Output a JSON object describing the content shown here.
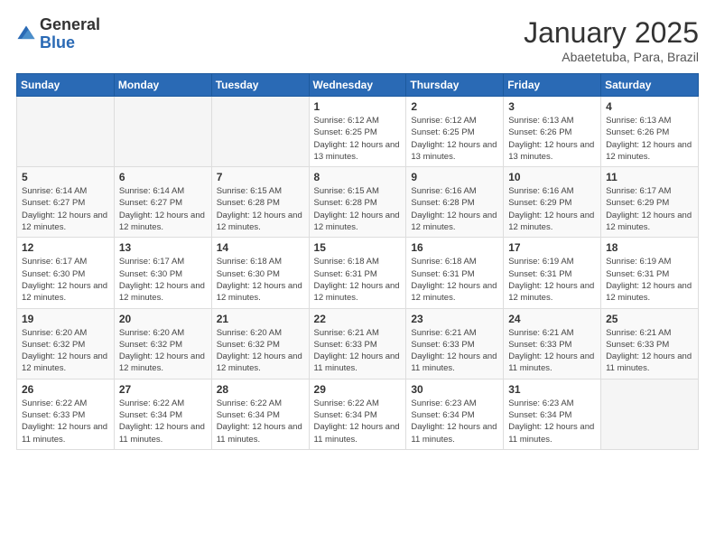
{
  "logo": {
    "general": "General",
    "blue": "Blue"
  },
  "title": "January 2025",
  "subtitle": "Abaetetuba, Para, Brazil",
  "weekdays": [
    "Sunday",
    "Monday",
    "Tuesday",
    "Wednesday",
    "Thursday",
    "Friday",
    "Saturday"
  ],
  "weeks": [
    [
      {
        "day": "",
        "info": ""
      },
      {
        "day": "",
        "info": ""
      },
      {
        "day": "",
        "info": ""
      },
      {
        "day": "1",
        "info": "Sunrise: 6:12 AM\nSunset: 6:25 PM\nDaylight: 12 hours and 13 minutes."
      },
      {
        "day": "2",
        "info": "Sunrise: 6:12 AM\nSunset: 6:25 PM\nDaylight: 12 hours and 13 minutes."
      },
      {
        "day": "3",
        "info": "Sunrise: 6:13 AM\nSunset: 6:26 PM\nDaylight: 12 hours and 13 minutes."
      },
      {
        "day": "4",
        "info": "Sunrise: 6:13 AM\nSunset: 6:26 PM\nDaylight: 12 hours and 12 minutes."
      }
    ],
    [
      {
        "day": "5",
        "info": "Sunrise: 6:14 AM\nSunset: 6:27 PM\nDaylight: 12 hours and 12 minutes."
      },
      {
        "day": "6",
        "info": "Sunrise: 6:14 AM\nSunset: 6:27 PM\nDaylight: 12 hours and 12 minutes."
      },
      {
        "day": "7",
        "info": "Sunrise: 6:15 AM\nSunset: 6:28 PM\nDaylight: 12 hours and 12 minutes."
      },
      {
        "day": "8",
        "info": "Sunrise: 6:15 AM\nSunset: 6:28 PM\nDaylight: 12 hours and 12 minutes."
      },
      {
        "day": "9",
        "info": "Sunrise: 6:16 AM\nSunset: 6:28 PM\nDaylight: 12 hours and 12 minutes."
      },
      {
        "day": "10",
        "info": "Sunrise: 6:16 AM\nSunset: 6:29 PM\nDaylight: 12 hours and 12 minutes."
      },
      {
        "day": "11",
        "info": "Sunrise: 6:17 AM\nSunset: 6:29 PM\nDaylight: 12 hours and 12 minutes."
      }
    ],
    [
      {
        "day": "12",
        "info": "Sunrise: 6:17 AM\nSunset: 6:30 PM\nDaylight: 12 hours and 12 minutes."
      },
      {
        "day": "13",
        "info": "Sunrise: 6:17 AM\nSunset: 6:30 PM\nDaylight: 12 hours and 12 minutes."
      },
      {
        "day": "14",
        "info": "Sunrise: 6:18 AM\nSunset: 6:30 PM\nDaylight: 12 hours and 12 minutes."
      },
      {
        "day": "15",
        "info": "Sunrise: 6:18 AM\nSunset: 6:31 PM\nDaylight: 12 hours and 12 minutes."
      },
      {
        "day": "16",
        "info": "Sunrise: 6:18 AM\nSunset: 6:31 PM\nDaylight: 12 hours and 12 minutes."
      },
      {
        "day": "17",
        "info": "Sunrise: 6:19 AM\nSunset: 6:31 PM\nDaylight: 12 hours and 12 minutes."
      },
      {
        "day": "18",
        "info": "Sunrise: 6:19 AM\nSunset: 6:31 PM\nDaylight: 12 hours and 12 minutes."
      }
    ],
    [
      {
        "day": "19",
        "info": "Sunrise: 6:20 AM\nSunset: 6:32 PM\nDaylight: 12 hours and 12 minutes."
      },
      {
        "day": "20",
        "info": "Sunrise: 6:20 AM\nSunset: 6:32 PM\nDaylight: 12 hours and 12 minutes."
      },
      {
        "day": "21",
        "info": "Sunrise: 6:20 AM\nSunset: 6:32 PM\nDaylight: 12 hours and 12 minutes."
      },
      {
        "day": "22",
        "info": "Sunrise: 6:21 AM\nSunset: 6:33 PM\nDaylight: 12 hours and 11 minutes."
      },
      {
        "day": "23",
        "info": "Sunrise: 6:21 AM\nSunset: 6:33 PM\nDaylight: 12 hours and 11 minutes."
      },
      {
        "day": "24",
        "info": "Sunrise: 6:21 AM\nSunset: 6:33 PM\nDaylight: 12 hours and 11 minutes."
      },
      {
        "day": "25",
        "info": "Sunrise: 6:21 AM\nSunset: 6:33 PM\nDaylight: 12 hours and 11 minutes."
      }
    ],
    [
      {
        "day": "26",
        "info": "Sunrise: 6:22 AM\nSunset: 6:33 PM\nDaylight: 12 hours and 11 minutes."
      },
      {
        "day": "27",
        "info": "Sunrise: 6:22 AM\nSunset: 6:34 PM\nDaylight: 12 hours and 11 minutes."
      },
      {
        "day": "28",
        "info": "Sunrise: 6:22 AM\nSunset: 6:34 PM\nDaylight: 12 hours and 11 minutes."
      },
      {
        "day": "29",
        "info": "Sunrise: 6:22 AM\nSunset: 6:34 PM\nDaylight: 12 hours and 11 minutes."
      },
      {
        "day": "30",
        "info": "Sunrise: 6:23 AM\nSunset: 6:34 PM\nDaylight: 12 hours and 11 minutes."
      },
      {
        "day": "31",
        "info": "Sunrise: 6:23 AM\nSunset: 6:34 PM\nDaylight: 12 hours and 11 minutes."
      },
      {
        "day": "",
        "info": ""
      }
    ]
  ]
}
